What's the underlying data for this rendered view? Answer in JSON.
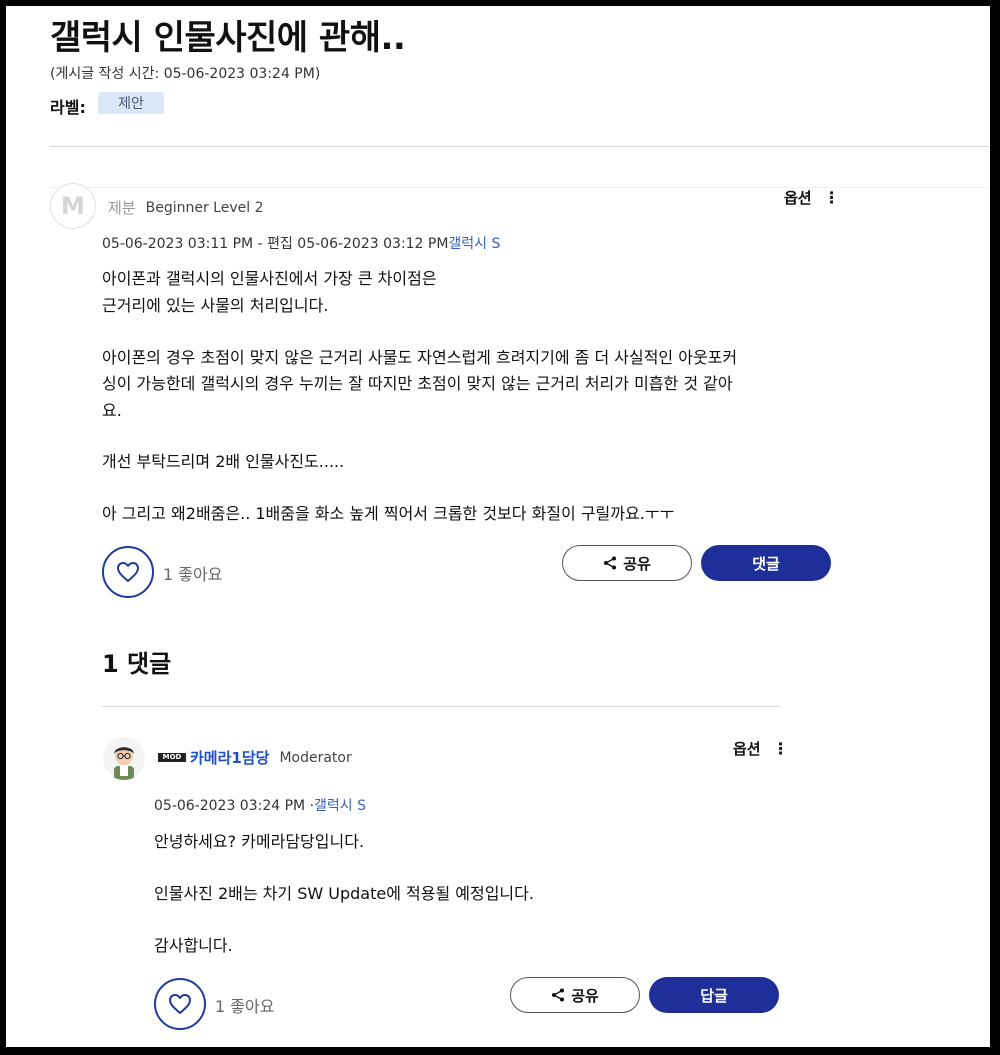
{
  "post": {
    "title": "갤럭시 인물사진에 관해..",
    "posted_time": "(게시글 작성 시간: 05-06-2023 03:24 PM)",
    "label_key": "라벨:",
    "label_value": "제안",
    "author": {
      "name": "제분",
      "rank": "Beginner Level 2",
      "avatar_letter": "M"
    },
    "meta_time": "05-06-2023 03:11 PM - 편집 05-06-2023 03:12 PM",
    "meta_board": "갤럭시 S",
    "options_label": "옵션",
    "kebab": "⋮",
    "body_lines": [
      "아이폰과 갤럭시의 인물사진에서 가장 큰 차이점은",
      "근거리에 있는 사물의 처리입니다.",
      "아이폰의 경우 초점이 맞지 않은 근거리 사물도 자연스럽게 흐려지기에 좀 더 사실적인 아웃포커",
      "싱이 가능한데 갤럭시의 경우 누끼는 잘 따지만 초점이 맞지 않는 근거리 처리가 미흡한 것 같아",
      "요.",
      "개선 부탁드리며 2배 인물사진도.....",
      "아 그리고 왜2배줌은.. 1배줌을 화소 높게 찍어서 크롭한 것보다 화질이 구릴까요.ㅜㅜ"
    ],
    "like_count": "1 좋아요",
    "share_label": "공유",
    "comment_label": "댓글"
  },
  "comments_section": {
    "title": "1 댓글"
  },
  "comment": {
    "badge": "MOD",
    "author_name": "카메라1담당",
    "author_rank": "Moderator",
    "meta_time": "05-06-2023 03:24 PM ·",
    "meta_board": "갤럭시 S",
    "options_label": "옵션",
    "kebab": "⋮",
    "body_lines": [
      "안녕하세요? 카메라담당입니다.",
      "인물사진 2배는 차기 SW Update에 적용될 예정입니다.",
      "감사합니다."
    ],
    "like_count": "1 좋아요",
    "share_label": "공유",
    "reply_label": "답글"
  },
  "colors": {
    "primary": "#1e2f9a",
    "link": "#3a62b6",
    "chip_bg": "#dbe7f6"
  }
}
